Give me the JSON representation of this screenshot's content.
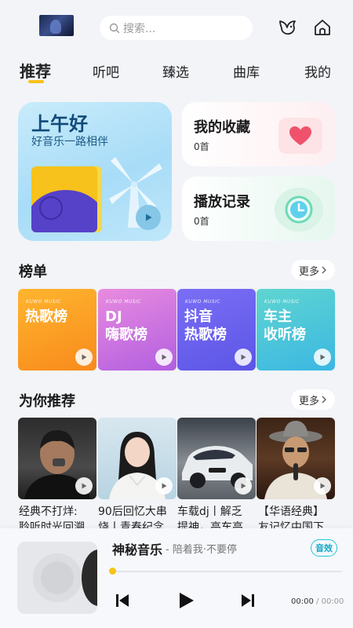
{
  "header": {
    "search_placeholder": "搜索..."
  },
  "tabs": [
    {
      "label": "推荐",
      "active": true
    },
    {
      "label": "听吧",
      "active": false
    },
    {
      "label": "臻选",
      "active": false
    },
    {
      "label": "曲库",
      "active": false
    },
    {
      "label": "我的",
      "active": false
    }
  ],
  "hero": {
    "greeting": "上午好",
    "subtitle": "好音乐一路相伴"
  },
  "favorites": {
    "title": "我的收藏",
    "count": "0首"
  },
  "history": {
    "title": "播放记录",
    "count": "0首"
  },
  "charts_section": {
    "title": "榜单",
    "more_label": "更多",
    "items": [
      {
        "tag": "KUWO MUSIC",
        "name": "热歌榜",
        "color_from": "#ffb52e",
        "color_to": "#f88a1c"
      },
      {
        "tag": "KUWO MUSIC",
        "name": "DJ\n嗨歌榜",
        "color_from": "#e98be0",
        "color_to": "#b25fe0"
      },
      {
        "tag": "KUWO MUSIC",
        "name": "抖音\n热歌榜",
        "color_from": "#7a6ef5",
        "color_to": "#5c55e6"
      },
      {
        "tag": "KUWO MUSIC",
        "name": "车主\n收听榜",
        "color_from": "#5fd5d0",
        "color_to": "#3bb7e3"
      }
    ]
  },
  "recommend_section": {
    "title": "为你推荐",
    "more_label": "更多",
    "items": [
      {
        "line1": "经典不打烊:",
        "line2": "聆听时光回溯"
      },
      {
        "line1": "90后回忆大串",
        "line2": "烧丨青春纪念"
      },
      {
        "line1": "车载dj丨解乏",
        "line2": "提神，高车高"
      },
      {
        "line1": "【华语经典】",
        "line2": "友记忆中国下"
      }
    ]
  },
  "player": {
    "title": "神秘音乐",
    "subtitle": "- 陪着我·不要停",
    "lyric_label": "音效",
    "current_time": "00:00",
    "separator": "/",
    "total_time": "00:00",
    "progress": 0
  }
}
